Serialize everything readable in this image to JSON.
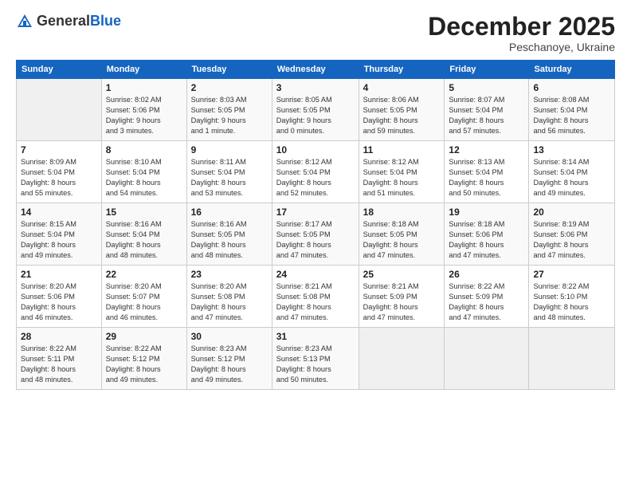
{
  "header": {
    "logo_general": "General",
    "logo_blue": "Blue",
    "month": "December 2025",
    "location": "Peschanoye, Ukraine"
  },
  "weekdays": [
    "Sunday",
    "Monday",
    "Tuesday",
    "Wednesday",
    "Thursday",
    "Friday",
    "Saturday"
  ],
  "rows": [
    [
      {
        "day": "",
        "text": ""
      },
      {
        "day": "1",
        "text": "Sunrise: 8:02 AM\nSunset: 5:06 PM\nDaylight: 9 hours\nand 3 minutes."
      },
      {
        "day": "2",
        "text": "Sunrise: 8:03 AM\nSunset: 5:05 PM\nDaylight: 9 hours\nand 1 minute."
      },
      {
        "day": "3",
        "text": "Sunrise: 8:05 AM\nSunset: 5:05 PM\nDaylight: 9 hours\nand 0 minutes."
      },
      {
        "day": "4",
        "text": "Sunrise: 8:06 AM\nSunset: 5:05 PM\nDaylight: 8 hours\nand 59 minutes."
      },
      {
        "day": "5",
        "text": "Sunrise: 8:07 AM\nSunset: 5:04 PM\nDaylight: 8 hours\nand 57 minutes."
      },
      {
        "day": "6",
        "text": "Sunrise: 8:08 AM\nSunset: 5:04 PM\nDaylight: 8 hours\nand 56 minutes."
      }
    ],
    [
      {
        "day": "7",
        "text": "Sunrise: 8:09 AM\nSunset: 5:04 PM\nDaylight: 8 hours\nand 55 minutes."
      },
      {
        "day": "8",
        "text": "Sunrise: 8:10 AM\nSunset: 5:04 PM\nDaylight: 8 hours\nand 54 minutes."
      },
      {
        "day": "9",
        "text": "Sunrise: 8:11 AM\nSunset: 5:04 PM\nDaylight: 8 hours\nand 53 minutes."
      },
      {
        "day": "10",
        "text": "Sunrise: 8:12 AM\nSunset: 5:04 PM\nDaylight: 8 hours\nand 52 minutes."
      },
      {
        "day": "11",
        "text": "Sunrise: 8:12 AM\nSunset: 5:04 PM\nDaylight: 8 hours\nand 51 minutes."
      },
      {
        "day": "12",
        "text": "Sunrise: 8:13 AM\nSunset: 5:04 PM\nDaylight: 8 hours\nand 50 minutes."
      },
      {
        "day": "13",
        "text": "Sunrise: 8:14 AM\nSunset: 5:04 PM\nDaylight: 8 hours\nand 49 minutes."
      }
    ],
    [
      {
        "day": "14",
        "text": "Sunrise: 8:15 AM\nSunset: 5:04 PM\nDaylight: 8 hours\nand 49 minutes."
      },
      {
        "day": "15",
        "text": "Sunrise: 8:16 AM\nSunset: 5:04 PM\nDaylight: 8 hours\nand 48 minutes."
      },
      {
        "day": "16",
        "text": "Sunrise: 8:16 AM\nSunset: 5:05 PM\nDaylight: 8 hours\nand 48 minutes."
      },
      {
        "day": "17",
        "text": "Sunrise: 8:17 AM\nSunset: 5:05 PM\nDaylight: 8 hours\nand 47 minutes."
      },
      {
        "day": "18",
        "text": "Sunrise: 8:18 AM\nSunset: 5:05 PM\nDaylight: 8 hours\nand 47 minutes."
      },
      {
        "day": "19",
        "text": "Sunrise: 8:18 AM\nSunset: 5:06 PM\nDaylight: 8 hours\nand 47 minutes."
      },
      {
        "day": "20",
        "text": "Sunrise: 8:19 AM\nSunset: 5:06 PM\nDaylight: 8 hours\nand 47 minutes."
      }
    ],
    [
      {
        "day": "21",
        "text": "Sunrise: 8:20 AM\nSunset: 5:06 PM\nDaylight: 8 hours\nand 46 minutes."
      },
      {
        "day": "22",
        "text": "Sunrise: 8:20 AM\nSunset: 5:07 PM\nDaylight: 8 hours\nand 46 minutes."
      },
      {
        "day": "23",
        "text": "Sunrise: 8:20 AM\nSunset: 5:08 PM\nDaylight: 8 hours\nand 47 minutes."
      },
      {
        "day": "24",
        "text": "Sunrise: 8:21 AM\nSunset: 5:08 PM\nDaylight: 8 hours\nand 47 minutes."
      },
      {
        "day": "25",
        "text": "Sunrise: 8:21 AM\nSunset: 5:09 PM\nDaylight: 8 hours\nand 47 minutes."
      },
      {
        "day": "26",
        "text": "Sunrise: 8:22 AM\nSunset: 5:09 PM\nDaylight: 8 hours\nand 47 minutes."
      },
      {
        "day": "27",
        "text": "Sunrise: 8:22 AM\nSunset: 5:10 PM\nDaylight: 8 hours\nand 48 minutes."
      }
    ],
    [
      {
        "day": "28",
        "text": "Sunrise: 8:22 AM\nSunset: 5:11 PM\nDaylight: 8 hours\nand 48 minutes."
      },
      {
        "day": "29",
        "text": "Sunrise: 8:22 AM\nSunset: 5:12 PM\nDaylight: 8 hours\nand 49 minutes."
      },
      {
        "day": "30",
        "text": "Sunrise: 8:23 AM\nSunset: 5:12 PM\nDaylight: 8 hours\nand 49 minutes."
      },
      {
        "day": "31",
        "text": "Sunrise: 8:23 AM\nSunset: 5:13 PM\nDaylight: 8 hours\nand 50 minutes."
      },
      {
        "day": "",
        "text": ""
      },
      {
        "day": "",
        "text": ""
      },
      {
        "day": "",
        "text": ""
      }
    ]
  ]
}
